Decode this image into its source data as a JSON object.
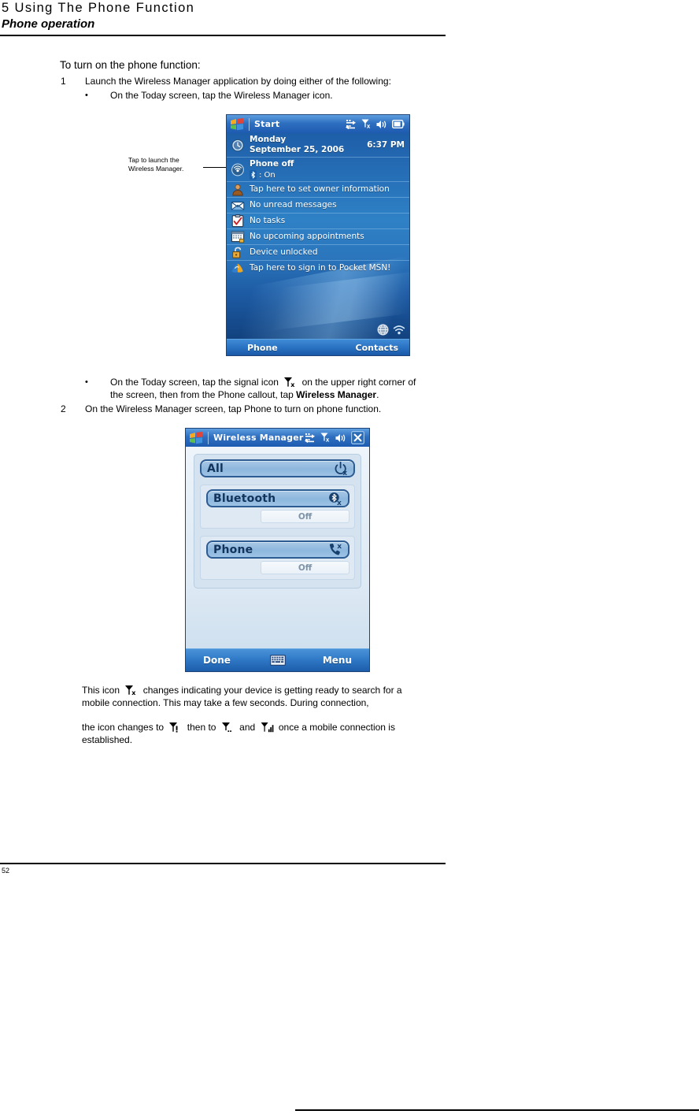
{
  "page": {
    "chapter_title": "5 Using The Phone Function",
    "section_title": "Phone operation",
    "page_number": "52"
  },
  "instructions": {
    "heading": "To turn on the phone function:",
    "step1_num": "1",
    "step1_text": "Launch the Wireless Manager application by doing either of the following:",
    "bullet_glyph": "•",
    "step1a_text": "On the Today screen, tap the Wireless Manager icon.",
    "step1b_prefix": "On the Today screen, tap the signal icon",
    "step1b_mid": "on the upper right corner of the screen, then from the Phone callout, tap",
    "step1b_bold": "Wireless Manager",
    "step1b_suffix": ".",
    "step2_num": "2",
    "step2_text": "On the Wireless Manager screen, tap Phone to turn on phone function."
  },
  "callout": {
    "line1": "Tap to launch the",
    "line2": "Wireless Manager."
  },
  "final_note": {
    "p1_prefix": "This icon",
    "p1_suffix": "changes indicating your device is getting ready to search for a mobile connection. This may take a few seconds. During connection,",
    "p2_prefix": "the icon changes to",
    "p2_mid1": "then to",
    "p2_mid2": "and",
    "p2_suffix": "once a mobile connection is established."
  },
  "today_screen": {
    "titlebar": {
      "start_label": "Start",
      "icons": [
        "connectivity-icon",
        "signal-no-service-icon",
        "volume-icon",
        "battery-icon"
      ]
    },
    "rows": [
      {
        "icon": "clock-icon",
        "text": "Monday",
        "text2": "September 25, 2006",
        "time": "6:37 PM",
        "bold": true
      },
      {
        "icon": "wireless-manager-icon",
        "text": "Phone off",
        "bluetooth_label": ": On",
        "bold": true
      },
      {
        "icon": "owner-icon",
        "text": "Tap here to set owner information"
      },
      {
        "icon": "messaging-icon",
        "text": "No unread messages"
      },
      {
        "icon": "tasks-icon",
        "text": "No tasks"
      },
      {
        "icon": "calendar-icon",
        "text": "No upcoming appointments"
      },
      {
        "icon": "lock-icon",
        "text": "Device unlocked"
      },
      {
        "icon": "pocket-msn-icon",
        "text": "Tap here to sign in to Pocket MSN!"
      }
    ],
    "tray_icons": [
      "globe-icon",
      "wifi-icon"
    ],
    "softkeys": {
      "left": "Phone",
      "right": "Contacts"
    }
  },
  "wireless_manager_screen": {
    "titlebar": {
      "title": "Wireless Manager",
      "icons": [
        "connectivity-icon",
        "signal-no-service-icon",
        "volume-icon",
        "close-icon"
      ]
    },
    "items": [
      {
        "label": "All",
        "icon": "power-off-icon"
      },
      {
        "label": "Bluetooth",
        "icon": "bluetooth-off-icon",
        "status": "Off"
      },
      {
        "label": "Phone",
        "icon": "phone-off-icon",
        "status": "Off"
      }
    ],
    "softkeys": {
      "left": "Done",
      "center": "keyboard-icon",
      "right": "Menu"
    }
  },
  "colors": {
    "titlebar_blue": "#2f6fc0",
    "today_blue": "#2670b8",
    "panel_blue": "#d5e3f0",
    "bar_blue": "#8db7dd",
    "bar_border": "#2d5c92"
  }
}
